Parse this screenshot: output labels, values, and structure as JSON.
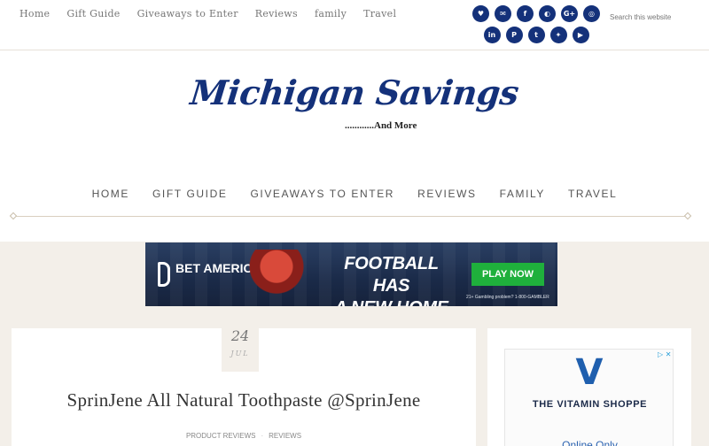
{
  "topnav": [
    "Home",
    "Gift Guide",
    "Giveaways to Enter",
    "Reviews",
    "family",
    "Travel"
  ],
  "social_row1": [
    {
      "icon": "heart-icon",
      "glyph": "♥"
    },
    {
      "icon": "email-icon",
      "glyph": "✉"
    },
    {
      "icon": "facebook-icon",
      "glyph": "f"
    },
    {
      "icon": "github-icon",
      "glyph": "◐"
    },
    {
      "icon": "google-plus-icon",
      "glyph": "G+"
    },
    {
      "icon": "instagram-icon",
      "glyph": "◎"
    }
  ],
  "social_row2": [
    {
      "icon": "linkedin-icon",
      "glyph": "in"
    },
    {
      "icon": "pinterest-icon",
      "glyph": "P"
    },
    {
      "icon": "tumblr-icon",
      "glyph": "t"
    },
    {
      "icon": "twitter-icon",
      "glyph": "✦"
    },
    {
      "icon": "youtube-icon",
      "glyph": "▶"
    }
  ],
  "search": {
    "placeholder": "Search this website"
  },
  "header": {
    "logo": "Michigan Savings",
    "tagline": "............And More"
  },
  "mainnav": [
    "HOME",
    "GIFT GUIDE",
    "GIVEAWAYS TO ENTER",
    "REVIEWS",
    "FAMILY",
    "TRAVEL"
  ],
  "ad": {
    "brand": "BET AMERICA",
    "headline_1": "FOOTBALL HAS",
    "headline_2": "A NEW HOME",
    "cta": "PLAY NOW",
    "fine_print": "21+ Gambling problem? 1-800-GAMBLER"
  },
  "post": {
    "day": "24",
    "month": "JUL",
    "title": "SprinJene All Natural Toothpaste @SprinJene",
    "categories": [
      "PRODUCT REVIEWS",
      "REVIEWS"
    ]
  },
  "sidebar_ad": {
    "brand": "THE VITAMIN SHOPPE",
    "sub": "Online Only",
    "logo_letter": "V",
    "adchoices": "▷ ✕"
  },
  "colors": {
    "brand_navy": "#14317a",
    "cta_green": "#1fb03c",
    "vitamin_blue": "#1f5fae"
  }
}
